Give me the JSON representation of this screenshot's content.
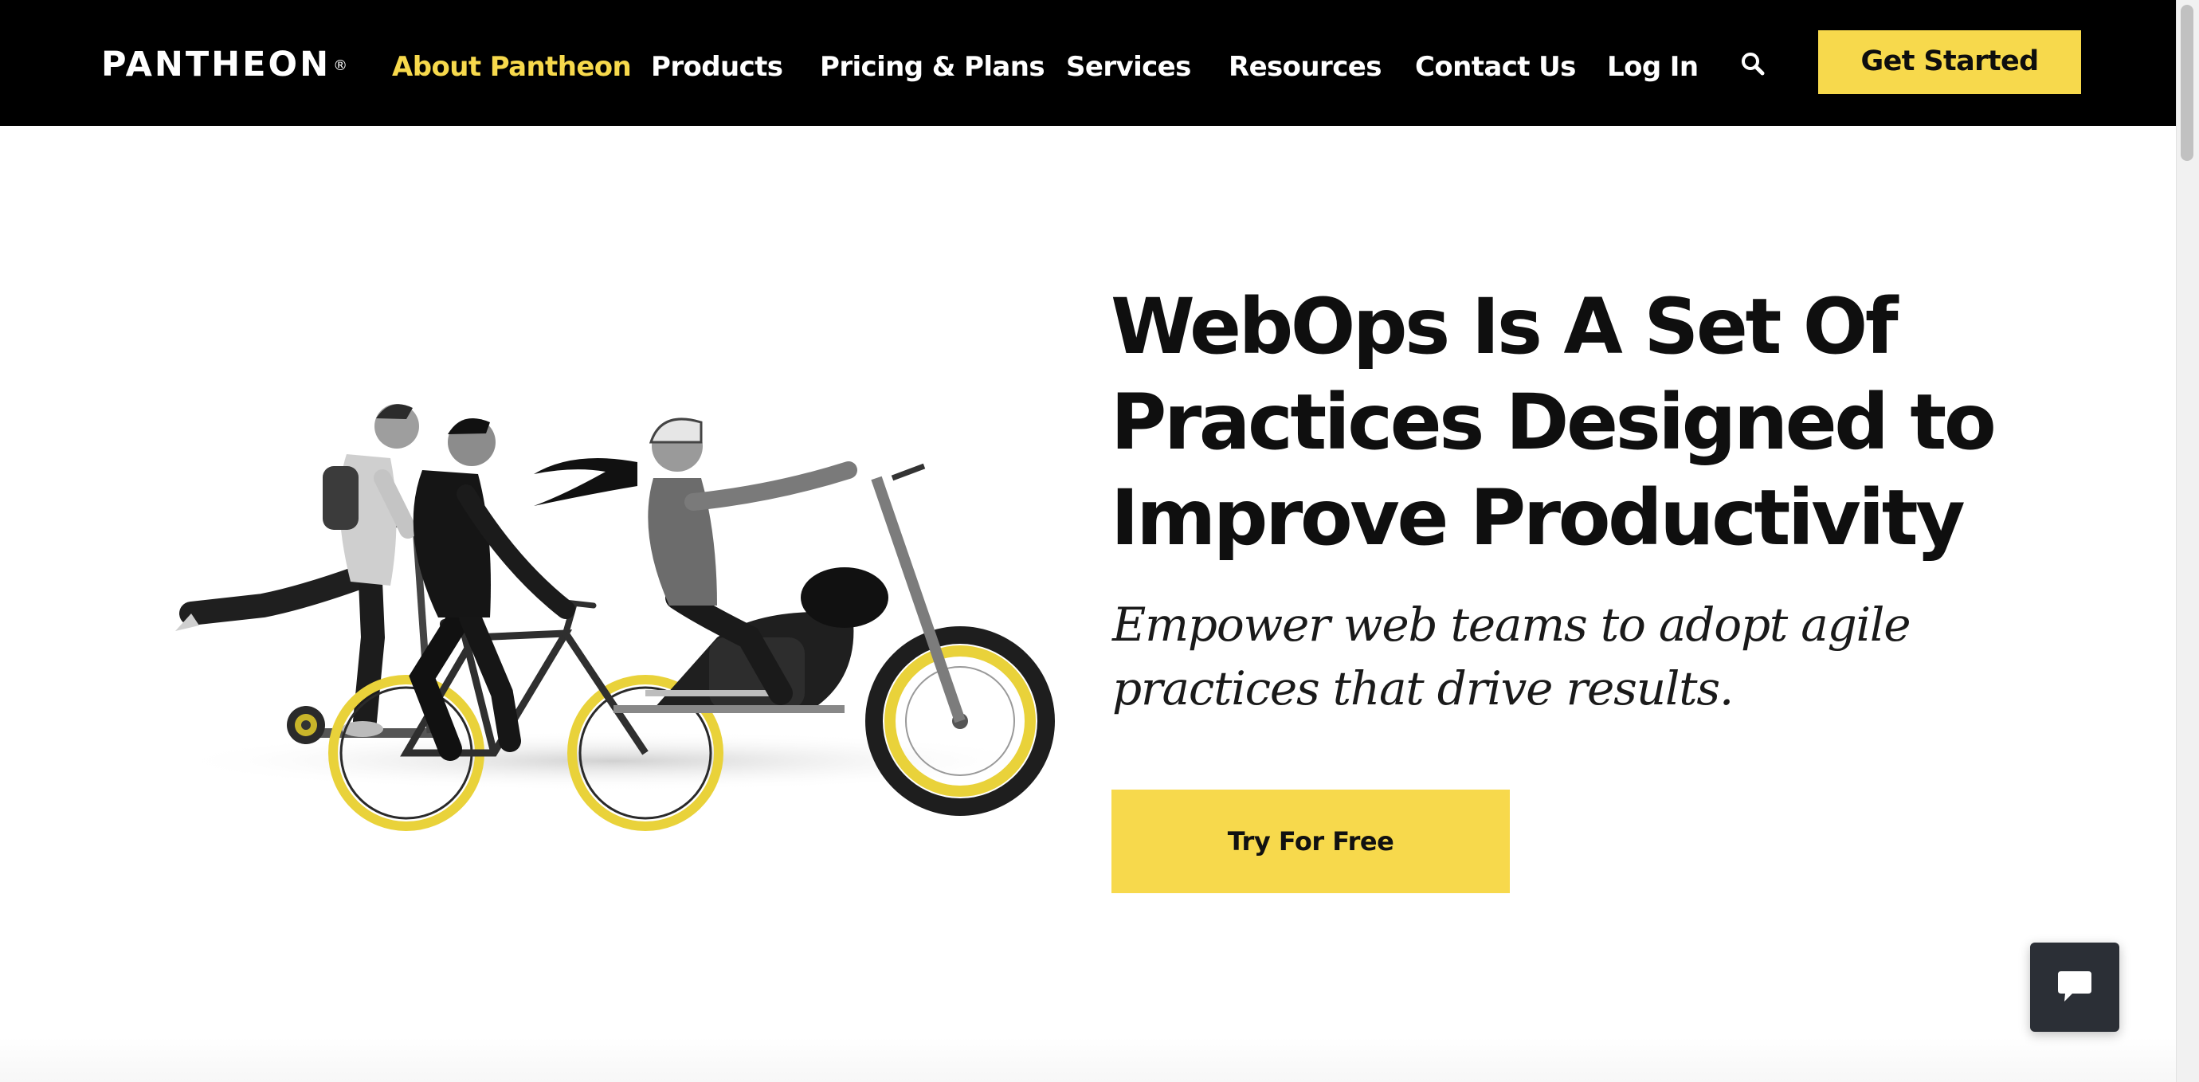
{
  "header": {
    "logo_text": "PANTHEON",
    "logo_mark": "®",
    "nav": [
      {
        "label": "About Pantheon",
        "active": true
      },
      {
        "label": "Products",
        "active": false
      },
      {
        "label": "Pricing & Plans",
        "active": false
      },
      {
        "label": "Services",
        "active": false
      },
      {
        "label": "Resources",
        "active": false
      },
      {
        "label": "Contact Us",
        "active": false
      },
      {
        "label": "Log In",
        "active": false
      }
    ],
    "search_icon": "search-icon",
    "cta_label": "Get Started"
  },
  "hero": {
    "headline": "WebOps Is A Set Of Practices Designed to Improve Productivity",
    "subheadline": "Empower web teams to adopt agile practices that drive results.",
    "cta_label": "Try For Free",
    "illustration": "riders-on-scooter-bicycle-motorcycle"
  },
  "chat": {
    "icon": "chat-bubble-icon"
  },
  "colors": {
    "header_bg": "#000000",
    "accent_yellow": "#f7d94c",
    "active_nav": "#f7d94c",
    "text_dark": "#0f0f0f",
    "chat_bg": "#2b2f36"
  }
}
